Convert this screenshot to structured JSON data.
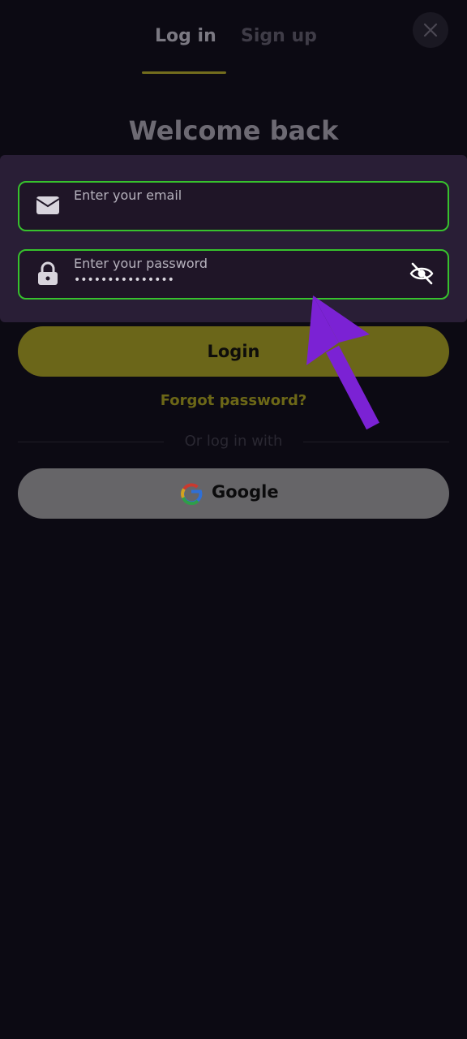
{
  "tabs": {
    "login": "Log in",
    "signup": "Sign up"
  },
  "title": "Welcome back",
  "email_field": {
    "label": "Enter your email",
    "value": ""
  },
  "password_field": {
    "label": "Enter your password",
    "value": "•••••••••••••••"
  },
  "login_button": "Login",
  "forgot_password": "Forgot password?",
  "divider_text": "Or log in with",
  "google_button": "Google",
  "icons": {
    "close": "close-icon",
    "email": "envelope-icon",
    "password": "lock-icon",
    "toggle": "eye-off-icon",
    "google": "google-icon"
  },
  "colors": {
    "background": "#0c0a13",
    "field_border": "#37c22d",
    "accent": "#6b6619",
    "annotation_arrow": "#7b22d4"
  }
}
